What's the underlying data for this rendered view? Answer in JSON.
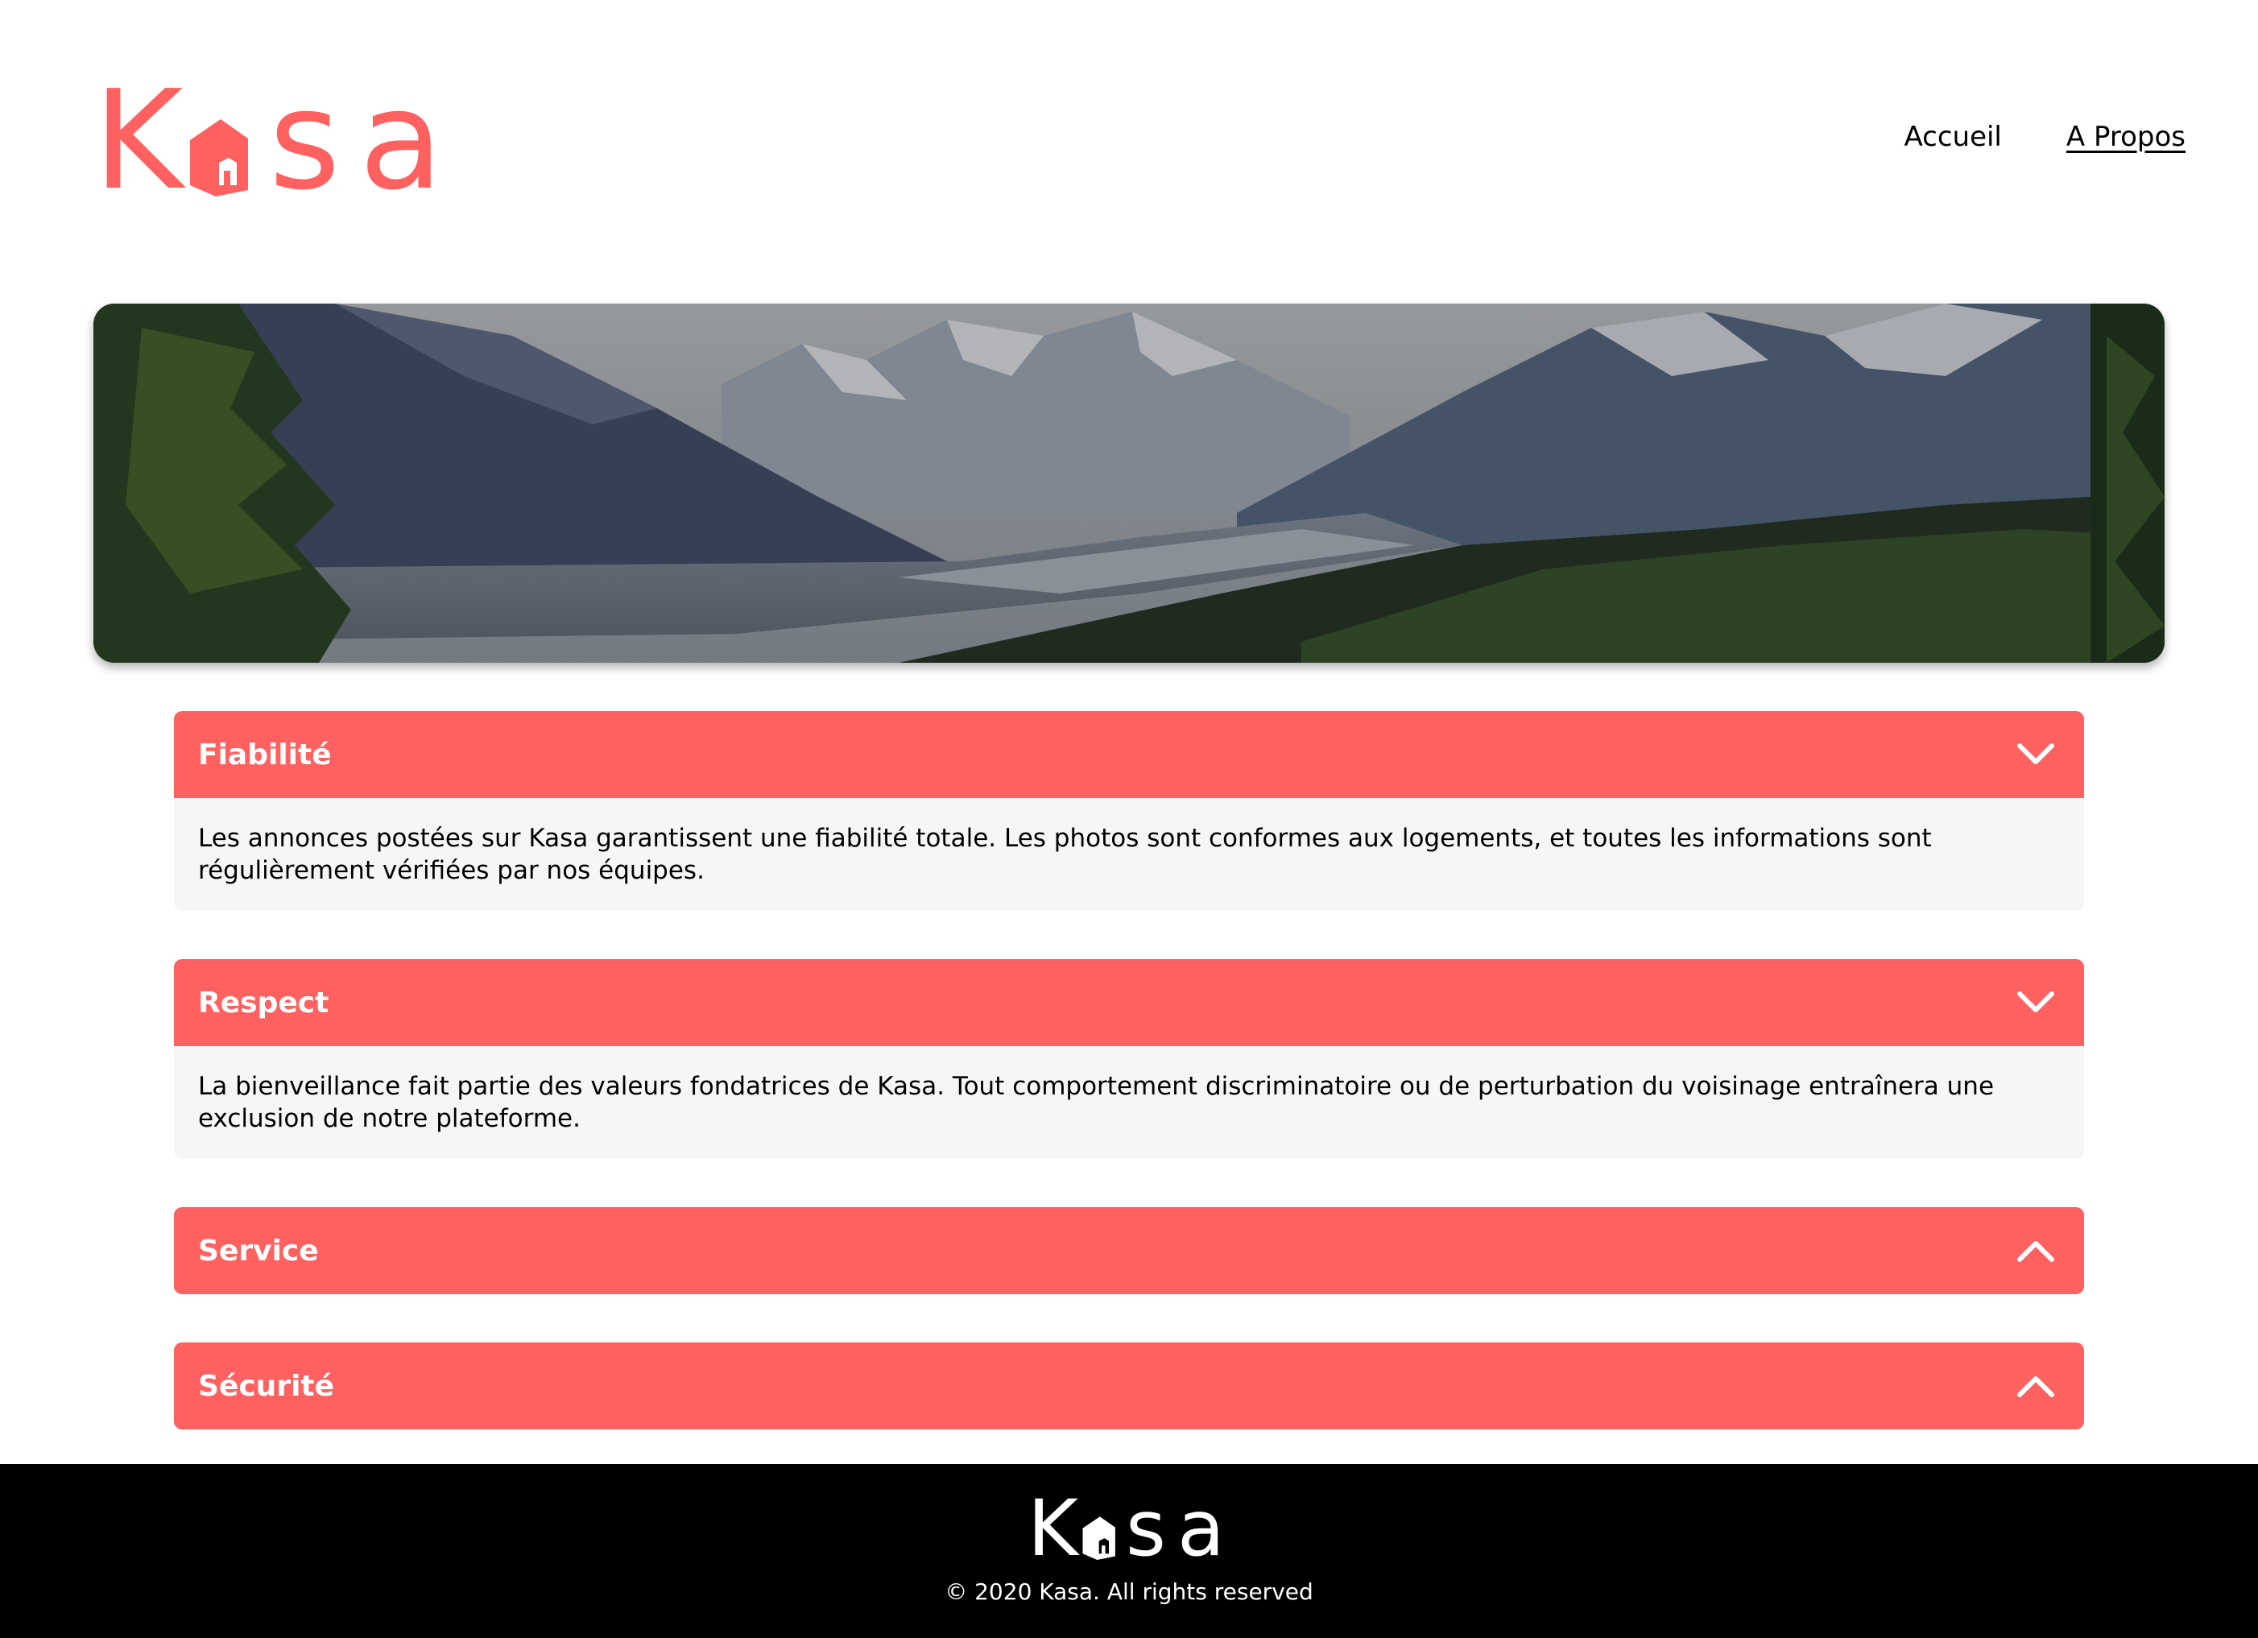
{
  "brand": {
    "logo_letters": [
      "K",
      "s",
      "a"
    ],
    "accent_color": "#FF6060"
  },
  "nav": {
    "home_label": "Accueil",
    "about_label": "A Propos"
  },
  "banner": {
    "image_alt": "banner-mountain-landscape"
  },
  "accordions": [
    {
      "title": "Fiabilité",
      "state": "open",
      "icon": "chevron-down-icon",
      "body": "Les annonces postées sur Kasa garantissent une fiabilité totale. Les photos sont conformes aux logements, et toutes les informations sont régulièrement vérifiées par nos équipes."
    },
    {
      "title": "Respect",
      "state": "open",
      "icon": "chevron-down-icon",
      "body": "La bienveillance fait partie des valeurs fondatrices de Kasa. Tout comportement discriminatoire ou de perturbation du voisinage entraînera une exclusion de notre plateforme."
    },
    {
      "title": "Service",
      "state": "closed",
      "icon": "chevron-up-icon"
    },
    {
      "title": "Sécurité",
      "state": "closed",
      "icon": "chevron-up-icon"
    }
  ],
  "footer": {
    "logo_letters": [
      "K",
      "s",
      "a"
    ],
    "copyright": "© 2020 Kasa. All rights reserved"
  }
}
